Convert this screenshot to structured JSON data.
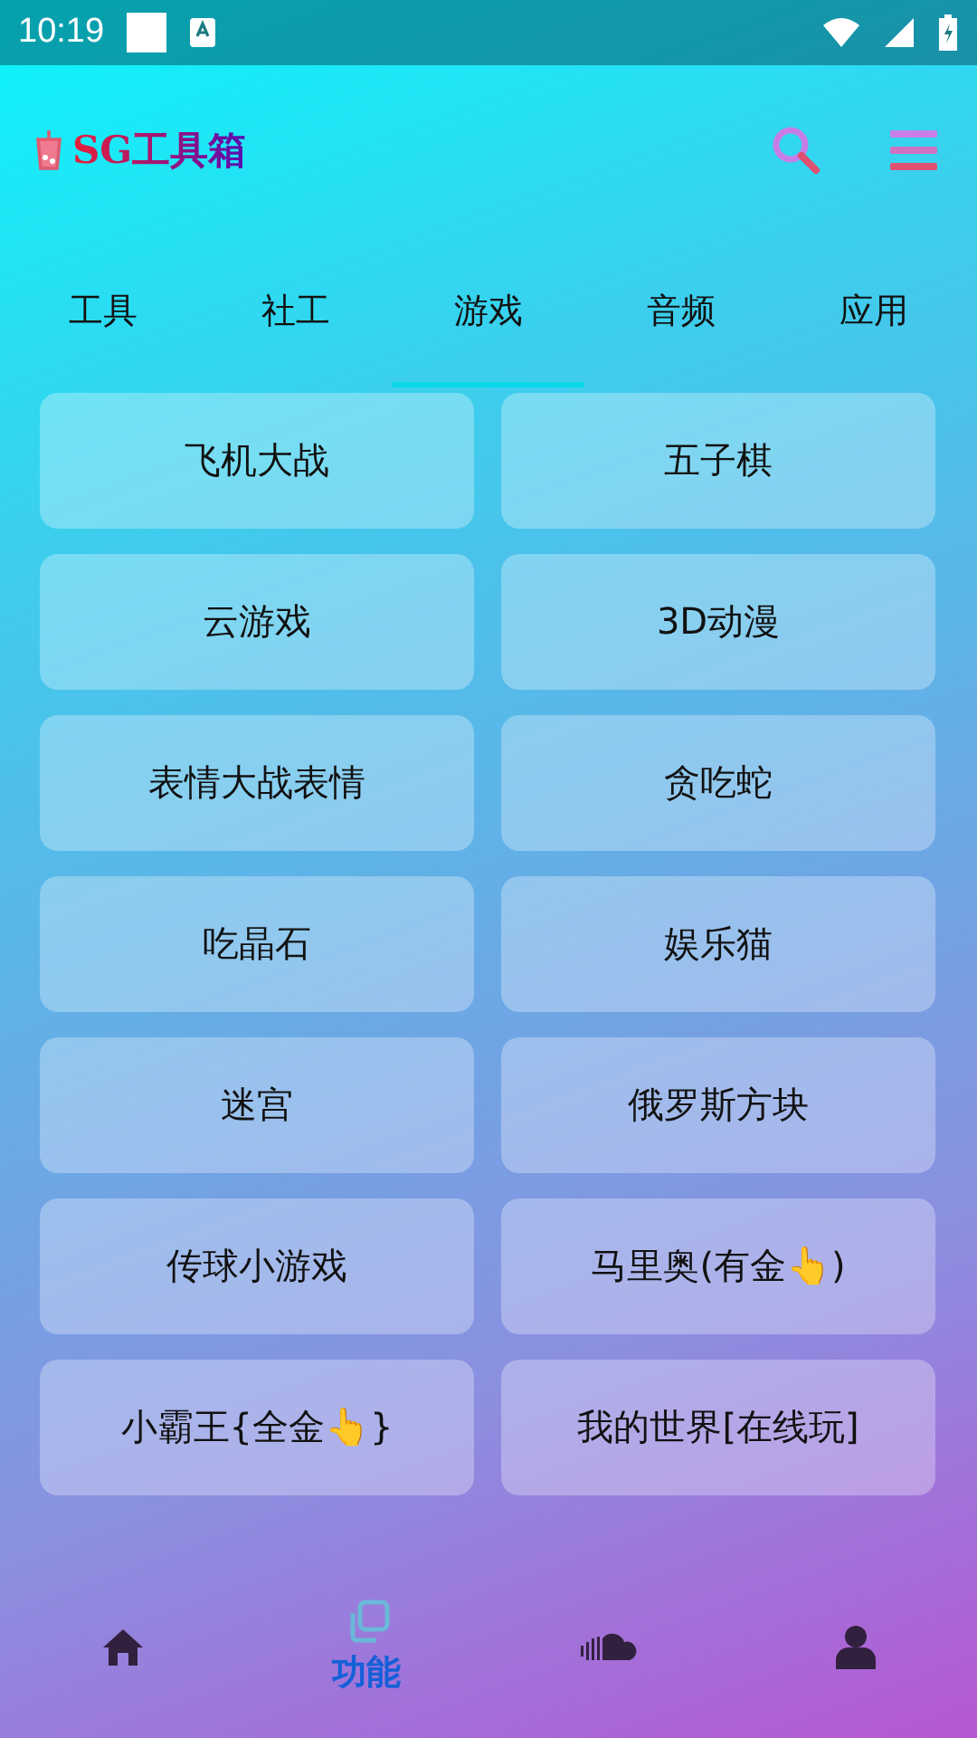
{
  "status_bar": {
    "time": "10:19"
  },
  "header": {
    "title": "SG工具箱"
  },
  "tabs": [
    {
      "label": "工具",
      "selected": false
    },
    {
      "label": "社工",
      "selected": false
    },
    {
      "label": "游戏",
      "selected": true
    },
    {
      "label": "音频",
      "selected": false
    },
    {
      "label": "应用",
      "selected": false
    }
  ],
  "items": [
    "飞机大战",
    "五子棋",
    "云游戏",
    "3D动漫",
    "表情大战表情",
    "贪吃蛇",
    "吃晶石",
    "娱乐猫",
    "迷宫",
    "俄罗斯方块",
    "传球小游戏",
    "马里奥(有金👆)",
    "小霸王{全金👆}",
    "我的世界[在线玩]"
  ],
  "bottom_nav": [
    {
      "kind": "home",
      "selected": false
    },
    {
      "kind": "features",
      "label": "功能",
      "selected": true
    },
    {
      "kind": "cloud",
      "selected": false
    },
    {
      "kind": "person",
      "selected": false
    }
  ]
}
